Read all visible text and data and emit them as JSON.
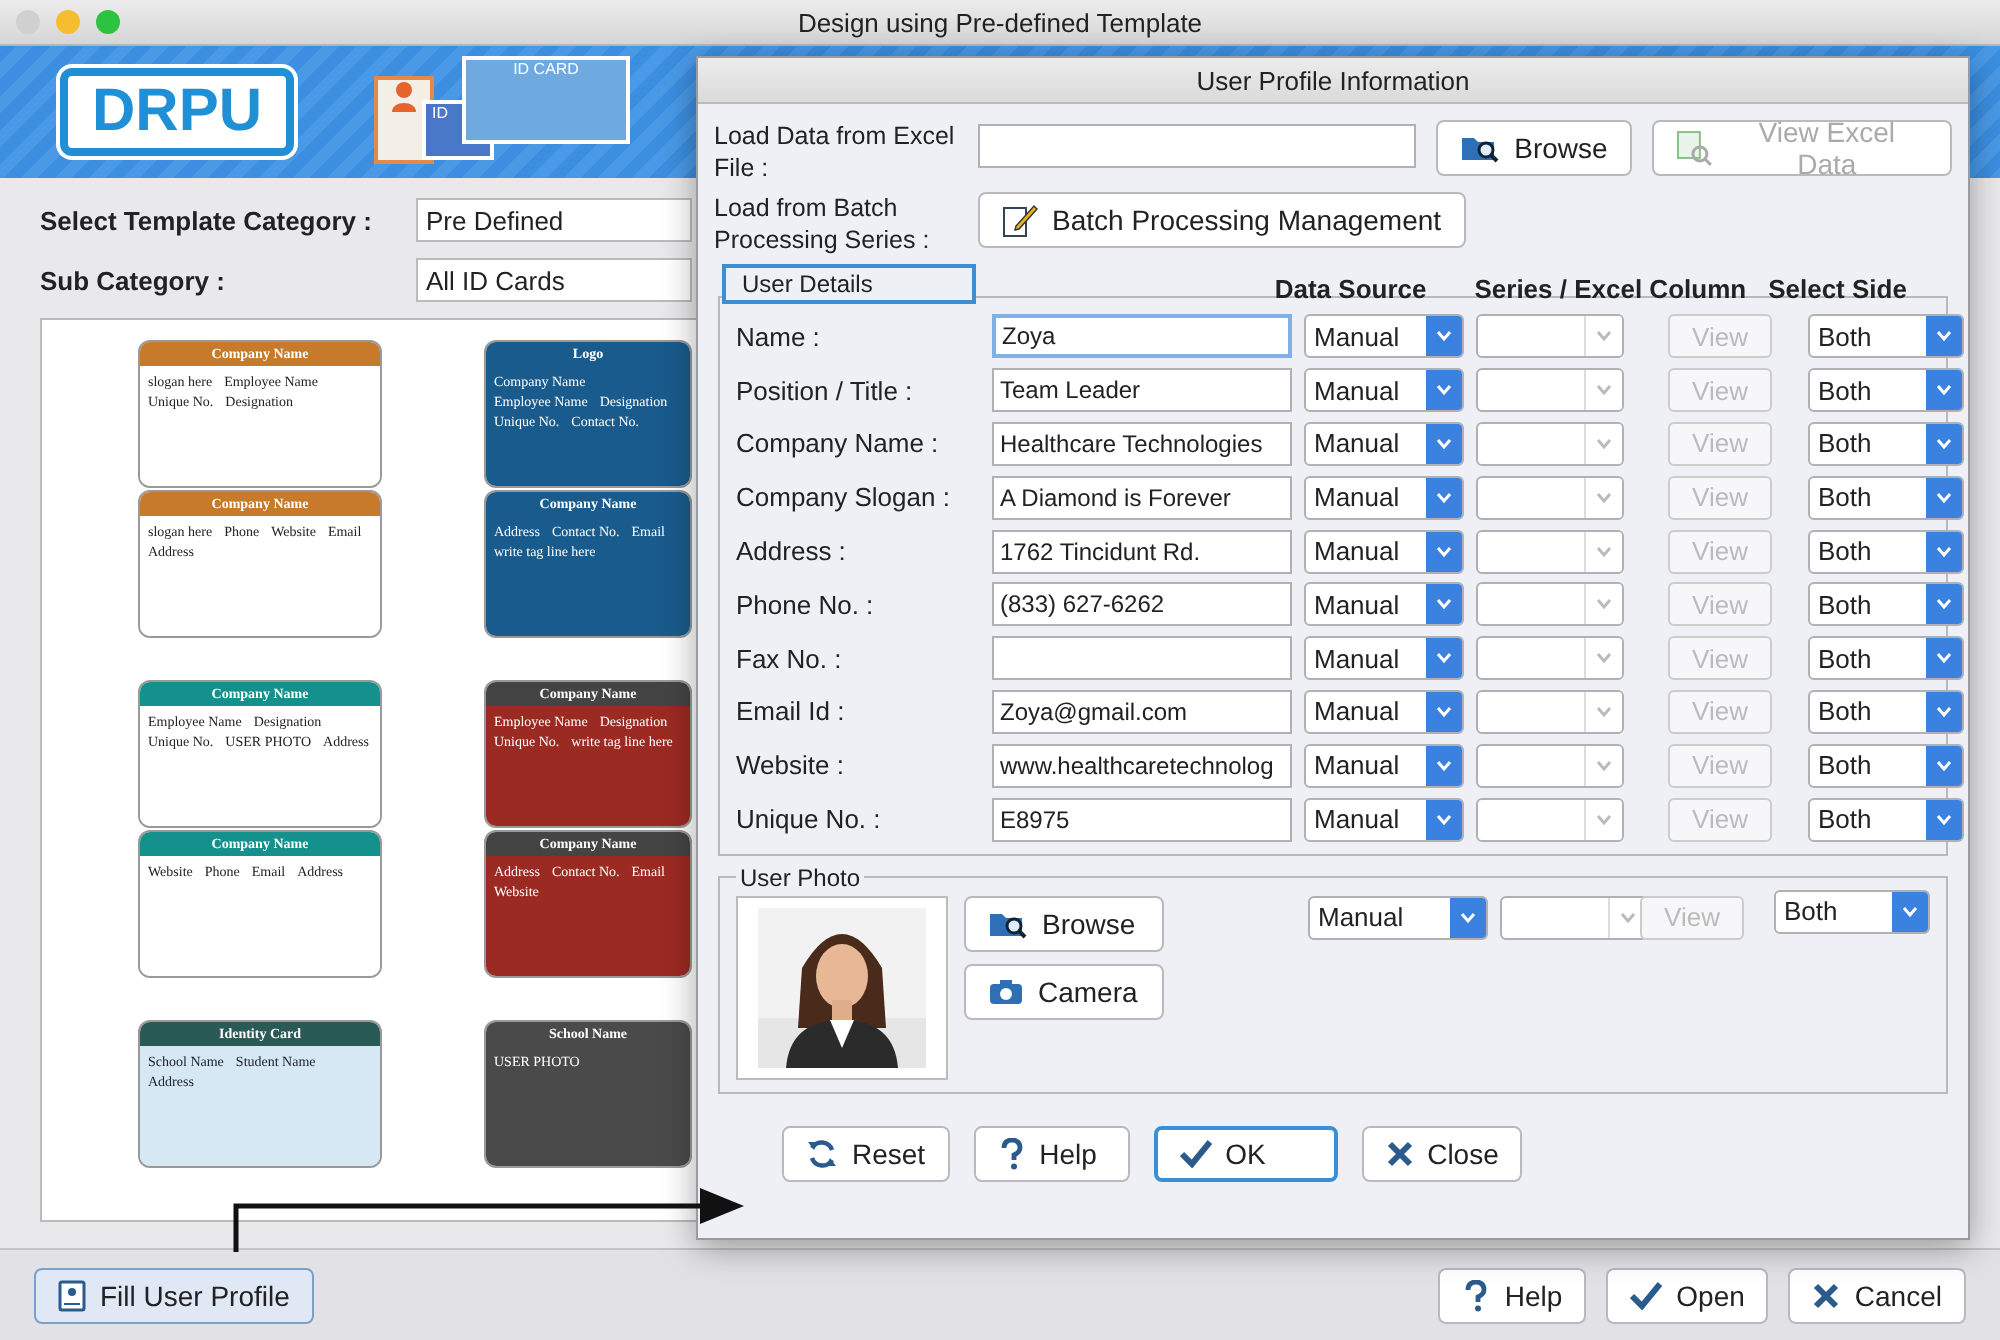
{
  "window": {
    "title": "Design using Pre-defined Template"
  },
  "header": {
    "logo": "DRPU",
    "card_label": "ID CARD",
    "small_card_label": "ID"
  },
  "category": {
    "label": "Select Template Category :",
    "value": "Pre Defined"
  },
  "sub_category": {
    "label": "Sub Category :",
    "value": "All ID Cards"
  },
  "templates": [
    {
      "kind": "orange",
      "sides": [
        [
          "Company Name",
          "slogan here",
          "Employee Name",
          "Unique No.",
          "Designation"
        ],
        [
          "Company Name",
          "slogan here",
          "Phone",
          "Website",
          "Email",
          "Address"
        ]
      ]
    },
    {
      "kind": "blue",
      "sides": [
        [
          "Logo",
          "Company Name",
          "Employee Name",
          "Designation",
          "Unique No.",
          "Contact No."
        ],
        [
          "Company Name",
          "Address",
          "Contact No.",
          "Email",
          "write tag line here"
        ]
      ]
    },
    {
      "kind": "teal",
      "sides": [
        [
          "Company Name",
          "Employee Name",
          "Designation",
          "Unique No.",
          "USER PHOTO",
          "Address"
        ],
        [
          "Company Name",
          "Website",
          "Phone",
          "Email",
          "Address"
        ]
      ]
    },
    {
      "kind": "red",
      "sides": [
        [
          "Company Name",
          "Employee Name",
          "Designation",
          "Unique No.",
          "write tag line here"
        ],
        [
          "Company Name",
          "Address",
          "Contact No.",
          "Email",
          "Website"
        ]
      ]
    },
    {
      "kind": "light",
      "sides": [
        [
          "Identity Card",
          "School Name",
          "Student Name",
          "Address"
        ]
      ]
    },
    {
      "kind": "dark",
      "sides": [
        [
          "School Name",
          "USER PHOTO"
        ]
      ]
    }
  ],
  "dialog": {
    "title": "User Profile Information",
    "excel_label": "Load Data from Excel File :",
    "browse": "Browse",
    "view_excel": "View Excel Data",
    "batch_label": "Load from Batch Processing Series :",
    "batch_button": "Batch Processing Management",
    "group_title": "User Details",
    "col_source": "Data Source",
    "col_series": "Series / Excel Column",
    "col_side": "Select Side",
    "fields": [
      {
        "label": "Name :",
        "value": "Zoya",
        "source": "Manual",
        "view": "View",
        "side": "Both",
        "focused": true
      },
      {
        "label": "Position / Title :",
        "value": "Team Leader",
        "source": "Manual",
        "view": "View",
        "side": "Both",
        "focused": false
      },
      {
        "label": "Company Name :",
        "value": "Healthcare Technologies",
        "source": "Manual",
        "view": "View",
        "side": "Both",
        "focused": false
      },
      {
        "label": "Company Slogan :",
        "value": "A Diamond is Forever",
        "source": "Manual",
        "view": "View",
        "side": "Both",
        "focused": false
      },
      {
        "label": "Address :",
        "value": "1762 Tincidunt Rd.",
        "source": "Manual",
        "view": "View",
        "side": "Both",
        "focused": false
      },
      {
        "label": "Phone No. :",
        "value": "(833) 627-6262",
        "source": "Manual",
        "view": "View",
        "side": "Both",
        "focused": false
      },
      {
        "label": "Fax No. :",
        "source": "Manual",
        "view": "View",
        "side": "Both",
        "focused": false
      },
      {
        "label": "Email Id :",
        "value": "Zoya@gmail.com",
        "source": "Manual",
        "view": "View",
        "side": "Both",
        "focused": false
      },
      {
        "label": "Website :",
        "value": "www.healthcaretechnolog",
        "source": "Manual",
        "view": "View",
        "side": "Both",
        "focused": false
      },
      {
        "label": "Unique No. :",
        "value": "E8975",
        "source": "Manual",
        "view": "View",
        "side": "Both",
        "focused": false
      }
    ],
    "photo": {
      "title": "User Photo",
      "browse": "Browse",
      "camera": "Camera",
      "source": "Manual",
      "view": "View",
      "side": "Both"
    },
    "buttons": [
      "Reset",
      "Help",
      "OK",
      "Close"
    ]
  },
  "footer": {
    "fill_button": "Fill User Profile",
    "buttons": [
      "Help",
      "Open",
      "Cancel"
    ]
  }
}
